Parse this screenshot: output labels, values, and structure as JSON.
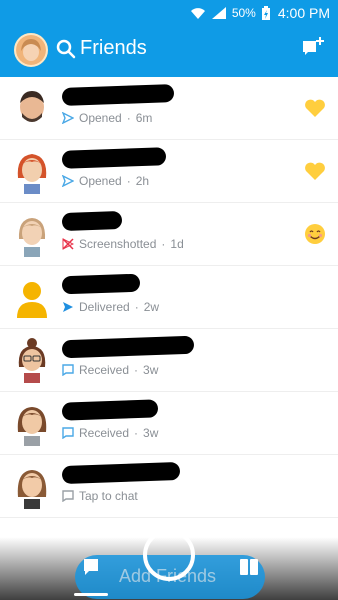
{
  "status_bar": {
    "battery": "50%",
    "time": "4:00 PM"
  },
  "header": {
    "title": "Friends"
  },
  "friends": [
    {
      "status_label": "Opened",
      "time": "6m",
      "status_icon": "sent-arrow-icon",
      "emoji": "yellow-heart"
    },
    {
      "status_label": "Opened",
      "time": "2h",
      "status_icon": "sent-arrow-icon",
      "emoji": "yellow-heart"
    },
    {
      "status_label": "Screenshotted",
      "time": "1d",
      "status_icon": "screenshot-icon",
      "emoji": "smiling-face"
    },
    {
      "status_label": "Delivered",
      "time": "2w",
      "status_icon": "delivered-arrow-icon",
      "emoji": ""
    },
    {
      "status_label": "Received",
      "time": "3w",
      "status_icon": "chat-bubble-icon",
      "emoji": ""
    },
    {
      "status_label": "Received",
      "time": "3w",
      "status_icon": "chat-bubble-icon",
      "emoji": ""
    },
    {
      "status_label": "Tap to chat",
      "time": "",
      "status_icon": "chat-bubble-outline-icon",
      "emoji": ""
    }
  ],
  "bottom": {
    "add_friends_label": "Add Friends"
  },
  "colors": {
    "header_blue": "#0f9be6",
    "sent_blue": "#4aa8e6",
    "screenshot_red": "#e8334a",
    "heart_yellow": "#ffce3e"
  }
}
